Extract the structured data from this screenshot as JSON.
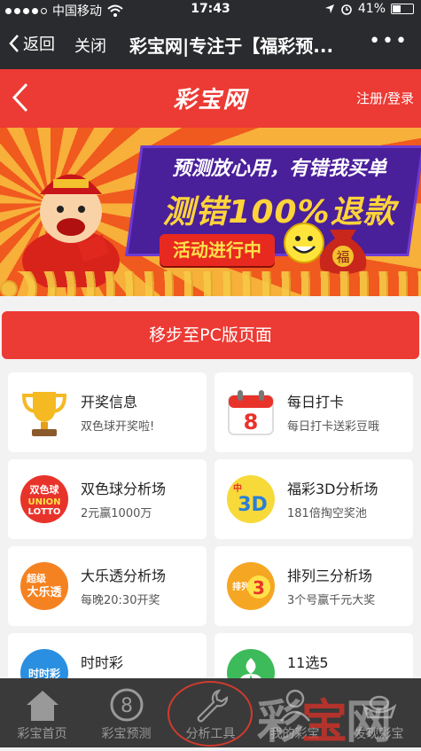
{
  "status_bar": {
    "carrier": "中国移动",
    "time": "17:43",
    "battery": "41%",
    "battery_level": 0.41
  },
  "wechat_bar": {
    "back_label": "返回",
    "close_label": "关闭",
    "title": "彩宝网|专注于【福彩预...",
    "more": "•••"
  },
  "app_header": {
    "logo": "彩宝网",
    "login": "注册/登录"
  },
  "banner": {
    "line1": "预测放心用，有错我买单",
    "line2": "测错100%退款",
    "pill": "活动进行中",
    "fu": "福"
  },
  "pc_button": "移步至PC版页面",
  "cards": [
    {
      "title": "开奖信息",
      "subtitle": "双色球开奖啦!",
      "icon": "trophy-icon"
    },
    {
      "title": "每日打卡",
      "subtitle": "每日打卡送彩豆哦",
      "icon": "calendar-icon",
      "badge": "8"
    },
    {
      "title": "双色球分析场",
      "subtitle": "2元赢1000万",
      "icon": "union-lotto-icon",
      "logo_lines": [
        "双色球",
        "UNION",
        "LOTTO"
      ]
    },
    {
      "title": "福彩3D分析场",
      "subtitle": "181倍掏空奖池",
      "icon": "fc3d-icon",
      "logo_lines": [
        "中",
        "3D"
      ]
    },
    {
      "title": "大乐透分析场",
      "subtitle": "每晚20:30开奖",
      "icon": "daletou-icon",
      "logo_lines": [
        "超级",
        "大乐透"
      ]
    },
    {
      "title": "排列三分析场",
      "subtitle": "3个号赢千元大奖",
      "icon": "pailie3-icon",
      "logo_lines": [
        "排列",
        "3"
      ]
    },
    {
      "title": "时时彩",
      "subtitle": "",
      "icon": "shishicai-icon",
      "logo_lines": [
        "时时彩"
      ]
    },
    {
      "title": "11选5",
      "subtitle": "",
      "icon": "11x5-icon"
    }
  ],
  "tabs": [
    {
      "label": "彩宝首页",
      "icon": "home-icon"
    },
    {
      "label": "彩宝预测",
      "icon": "eight-circle-icon",
      "glyph": "8"
    },
    {
      "label": "分析工具",
      "icon": "wrench-icon"
    },
    {
      "label": "我的彩宝",
      "icon": "user-icon"
    },
    {
      "label": "发现彩宝",
      "icon": "ingot-icon"
    }
  ],
  "watermark": {
    "part1": "彩",
    "part2": "宝",
    "part3": "网"
  },
  "colors": {
    "brand_red": "#ec3a34",
    "bar_dark": "#2a2b2e",
    "tab_dark": "#3a3a3a",
    "highlight_ring": "#d23a2e"
  }
}
